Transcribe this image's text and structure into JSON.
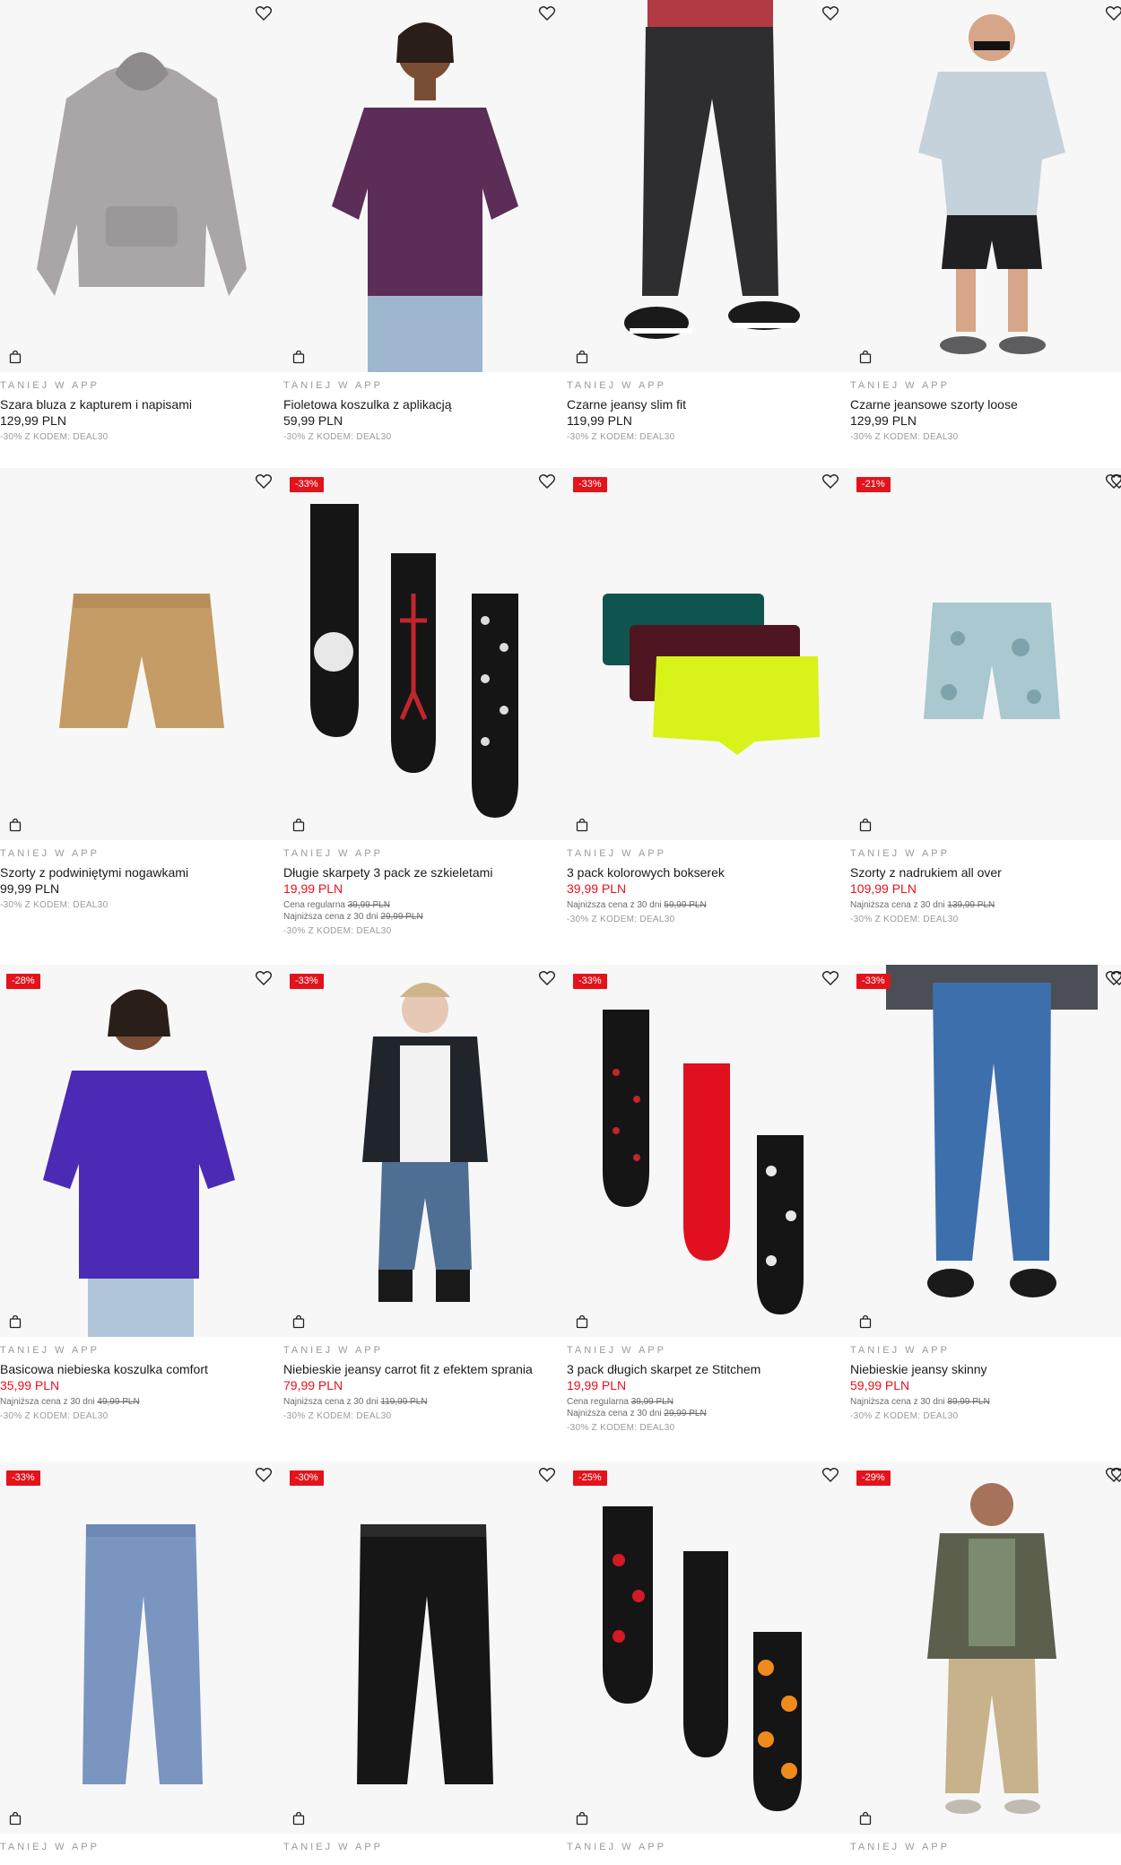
{
  "colors": {
    "accent": "#e3131b",
    "promo": "#9a9a9a"
  },
  "icons": {
    "heart": "heart-icon",
    "bag": "shopping-bag-icon"
  },
  "products": [
    {
      "name": "Szara bluza z kapturem i napisami",
      "price": "129,99 PLN",
      "promo": "TANIEJ W APP",
      "code": "-30% Z KODEM: DEAL30"
    },
    {
      "name": "Fioletowa koszulka z aplikacją",
      "price": "59,99 PLN",
      "promo": "TANIEJ W APP",
      "code": "-30% Z KODEM: DEAL30"
    },
    {
      "name": "Czarne jeansy slim fit",
      "price": "119,99 PLN",
      "promo": "TANIEJ W APP",
      "code": "-30% Z KODEM: DEAL30"
    },
    {
      "name": "Czarne jeansowe szorty loose",
      "price": "129,99 PLN",
      "promo": "TANIEJ W APP",
      "code": "-30% Z KODEM: DEAL30"
    },
    {
      "name": "Szorty z podwiniętymi nogawkami",
      "price": "99,99 PLN",
      "promo": "TANIEJ W APP",
      "code": "-30% Z KODEM: DEAL30"
    },
    {
      "name": "Długie skarpety 3 pack ze szkieletami",
      "price": "19,99 PLN",
      "discount": "-33%",
      "promo": "TANIEJ W APP",
      "regular_label": "Cena regularna",
      "regular_price": "39,99 PLN",
      "lowest_label": "Najniższa cena z 30 dni",
      "lowest_price": "29,99 PLN",
      "code": "-30% Z KODEM: DEAL30"
    },
    {
      "name": "3 pack kolorowych bokserek",
      "price": "39,99 PLN",
      "discount": "-33%",
      "promo": "TANIEJ W APP",
      "lowest_label": "Najniższa cena z 30 dni",
      "lowest_price": "59,99 PLN",
      "code": "-30% Z KODEM: DEAL30"
    },
    {
      "name": "Szorty z nadrukiem all over",
      "price": "109,99 PLN",
      "discount": "-21%",
      "promo": "TANIEJ W APP",
      "lowest_label": "Najniższa cena z 30 dni",
      "lowest_price": "139,99 PLN",
      "code": "-30% Z KODEM: DEAL30"
    },
    {
      "name": "Basicowa niebieska koszulka comfort",
      "price": "35,99 PLN",
      "discount": "-28%",
      "promo": "TANIEJ W APP",
      "lowest_label": "Najniższa cena z 30 dni",
      "lowest_price": "49,99 PLN",
      "code": "-30% Z KODEM: DEAL30"
    },
    {
      "name": "Niebieskie jeansy carrot fit z efektem sprania",
      "price": "79,99 PLN",
      "discount": "-33%",
      "promo": "TANIEJ W APP",
      "lowest_label": "Najniższa cena z 30 dni",
      "lowest_price": "119,99 PLN",
      "code": "-30% Z KODEM: DEAL30"
    },
    {
      "name": "3 pack długich skarpet ze Stitchem",
      "price": "19,99 PLN",
      "discount": "-33%",
      "promo": "TANIEJ W APP",
      "regular_label": "Cena regularna",
      "regular_price": "39,99 PLN",
      "lowest_label": "Najniższa cena z 30 dni",
      "lowest_price": "29,99 PLN",
      "code": "-30% Z KODEM: DEAL30"
    },
    {
      "name": "Niebieskie jeansy skinny",
      "price": "59,99 PLN",
      "discount": "-33%",
      "promo": "TANIEJ W APP",
      "lowest_label": "Najniższa cena z 30 dni",
      "lowest_price": "89,99 PLN",
      "code": "-30% Z KODEM: DEAL30"
    },
    {
      "discount": "-33%",
      "promo": "TANIEJ W APP"
    },
    {
      "discount": "-30%",
      "promo": "TANIEJ W APP"
    },
    {
      "discount": "-25%",
      "promo": "TANIEJ W APP"
    },
    {
      "discount": "-29%",
      "promo": "TANIEJ W APP"
    }
  ]
}
